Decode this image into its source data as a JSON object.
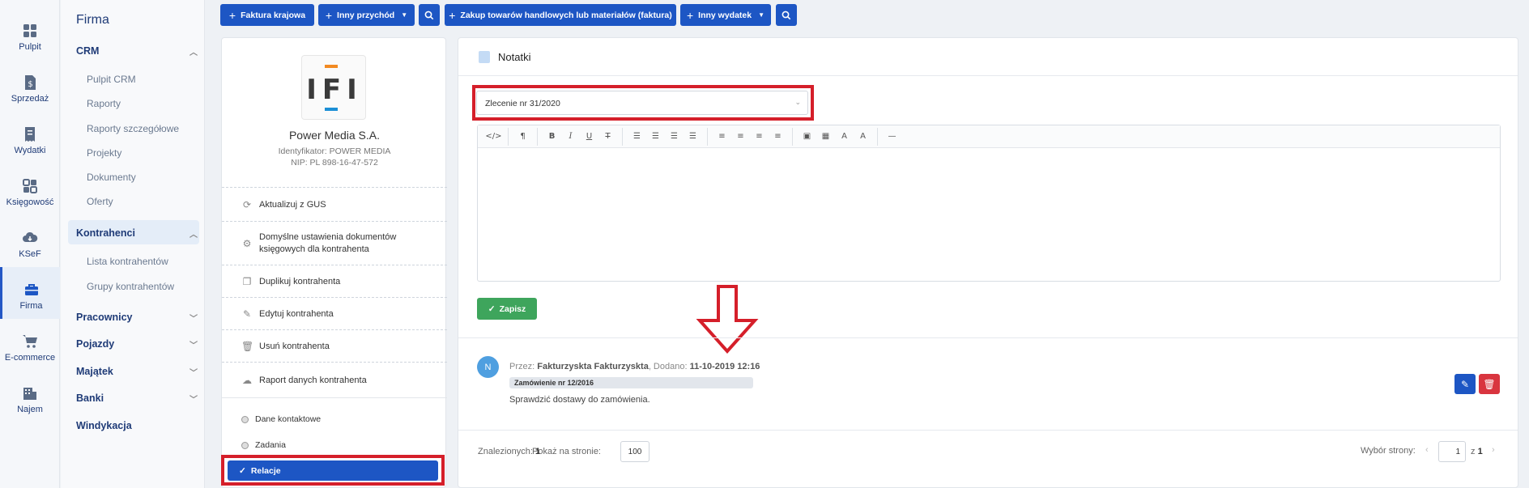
{
  "rail": [
    {
      "label": "Pulpit",
      "icon": "dashboard-icon"
    },
    {
      "label": "Sprzedaż",
      "icon": "invoice-icon"
    },
    {
      "label": "Wydatki",
      "icon": "receipt-icon"
    },
    {
      "label": "Księgowość",
      "icon": "accounting-icon"
    },
    {
      "label": "KSeF",
      "icon": "cloud-download-icon"
    },
    {
      "label": "Firma",
      "icon": "briefcase-icon"
    },
    {
      "label": "E-commerce",
      "icon": "cart-icon"
    },
    {
      "label": "Najem",
      "icon": "building-icon"
    }
  ],
  "sidebar": {
    "title": "Firma",
    "crm": "CRM",
    "crm_items": [
      "Pulpit CRM",
      "Raporty",
      "Raporty szczegółowe",
      "Projekty",
      "Dokumenty",
      "Oferty"
    ],
    "kontrahenci": "Kontrahenci",
    "kontrahenci_items": [
      "Lista kontrahentów",
      "Grupy kontrahentów"
    ],
    "pracownicy": "Pracownicy",
    "pojazdy": "Pojazdy",
    "majatek": "Majątek",
    "banki": "Banki",
    "windykacja": "Windykacja"
  },
  "toolbar": {
    "faktura": "Faktura krajowa",
    "inny_przychod": "Inny przychód",
    "zakup": "Zakup towarów handlowych lub materiałów (faktura)",
    "inny_wydatek": "Inny wydatek"
  },
  "contractor": {
    "logo_text": "IFI",
    "name": "Power Media S.A.",
    "identifier": "Identyfikator: POWER MEDIA",
    "nip": "NIP: PL 898-16-47-572"
  },
  "actions": {
    "gus": "Aktualizuj z GUS",
    "defaults": "Domyślne ustawienia dokumentów księgowych dla kontrahenta",
    "duplicate": "Duplikuj kontrahenta",
    "edit": "Edytuj kontrahenta",
    "delete": "Usuń kontrahenta",
    "report": "Raport danych kontrahenta"
  },
  "links": {
    "contact": "Dane kontaktowe",
    "tasks": "Zadania",
    "relations": "Relacje"
  },
  "notes": {
    "title": "Notatki",
    "select_value": "Zlecenie nr 31/2020",
    "save": "Zapisz",
    "note": {
      "avatar": "N",
      "by_label": "Przez:",
      "author": "Fakturzyskta Fakturzyskta",
      "added_label": ", Dodano:",
      "date": "11-10-2019 12:16",
      "tag": "Zamówienie nr 12/2016",
      "text": "Sprawdzić dostawy do zamówienia."
    },
    "found_label": "Znalezionych:",
    "found": "1",
    "per_page_label": "Pokaż na stronie:",
    "per_page": "100",
    "page_label": "Wybór strony:",
    "page": "1",
    "of_label": "z",
    "total_pages": "1"
  },
  "colors": {
    "primary": "#1d56c4",
    "success": "#3ea55c",
    "danger": "#d9353f",
    "highlight": "#d51f2a"
  }
}
